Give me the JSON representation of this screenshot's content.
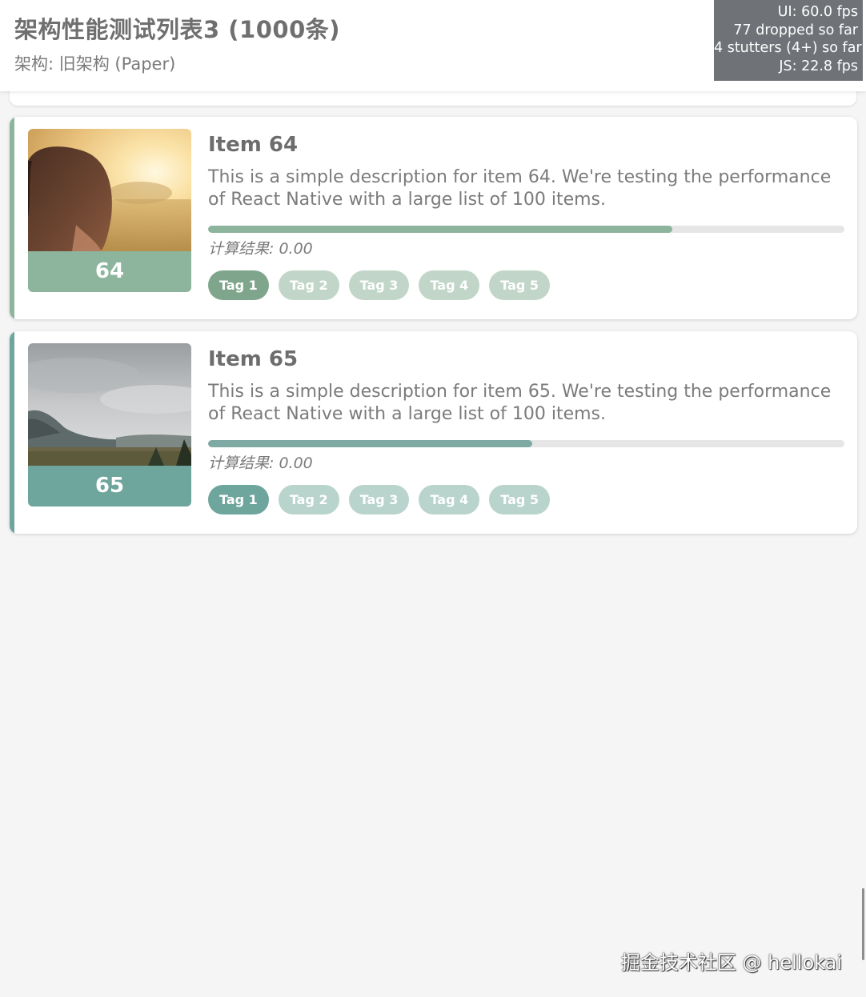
{
  "header": {
    "title": "架构性能测试列表3 (1000条)",
    "subtitle": "架构: 旧架构 (Paper)"
  },
  "perf_monitor": {
    "ui_fps": "UI: 60.0 fps",
    "dropped": "77 dropped so far",
    "stutters": "4 stutters (4+) so far",
    "js_fps": "JS: 22.8 fps"
  },
  "items": [
    {
      "title": "Item 64",
      "number": "64",
      "description": "This is a simple description for item 64. We're testing the performance of React Native with a large list of 100 items.",
      "progress": 0.73,
      "result": "计算结果: 0.00",
      "accent_color": "#8db59d",
      "photo_alt": "sunlit field with girl",
      "tags": [
        "Tag 1",
        "Tag 2",
        "Tag 3",
        "Tag 4",
        "Tag 5"
      ]
    },
    {
      "title": "Item 65",
      "number": "65",
      "description": "This is a simple description for item 65. We're testing the performance of React Native with a large list of 100 items.",
      "progress": 0.51,
      "result": "计算结果: 0.00",
      "accent_color": "#6ea59c",
      "photo_alt": "cloudy mountain landscape",
      "tags": [
        "Tag 1",
        "Tag 2",
        "Tag 3",
        "Tag 4",
        "Tag 5"
      ]
    }
  ],
  "watermark": "掘金技术社区 @ hellokai"
}
